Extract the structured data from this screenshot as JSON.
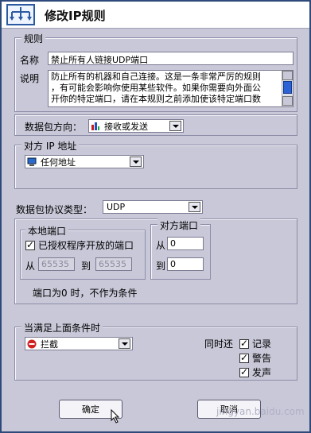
{
  "window": {
    "title": "修改IP规则"
  },
  "rule": {
    "legend": "规则",
    "name_label": "名称",
    "name_value": "禁止所有人链接UDP端口",
    "desc_label": "说明",
    "desc_lines": [
      "防止所有的机器和自己连接。这是一条非常严厉的规则",
      "，有可能会影响你使用某些软件。如果你需要向外面公",
      "开你的特定端口，请在本规则之前添加使该特定端口数"
    ]
  },
  "direction": {
    "label": "数据包方向：",
    "value": "接收或发送",
    "icon": "send-receive-icon"
  },
  "remote_ip": {
    "legend": "对方 IP 地址",
    "value": "任何地址",
    "icon": "computer-icon"
  },
  "protocol": {
    "label": "数据包协议类型：",
    "value": "UDP"
  },
  "local_port": {
    "legend": "本地端口",
    "checkbox_label": "已授权程序开放的端口",
    "checked": true,
    "from_label": "从",
    "from_value": "65535",
    "to_label": "到",
    "to_value": "65535"
  },
  "remote_port": {
    "legend": "对方端口",
    "from_label": "从",
    "from_value": "0",
    "to_label": "到",
    "to_value": "0"
  },
  "port_note": "端口为0 时，不作为条件",
  "action": {
    "legend": "当满足上面条件时",
    "value": "拦截",
    "icon": "block-icon",
    "also_label": "同时还",
    "options": [
      {
        "label": "记录",
        "checked": true
      },
      {
        "label": "警告",
        "checked": true
      },
      {
        "label": "发声",
        "checked": true
      }
    ]
  },
  "buttons": {
    "ok": "确定",
    "cancel": "取消"
  },
  "watermark": "jingyan.baidu.com"
}
